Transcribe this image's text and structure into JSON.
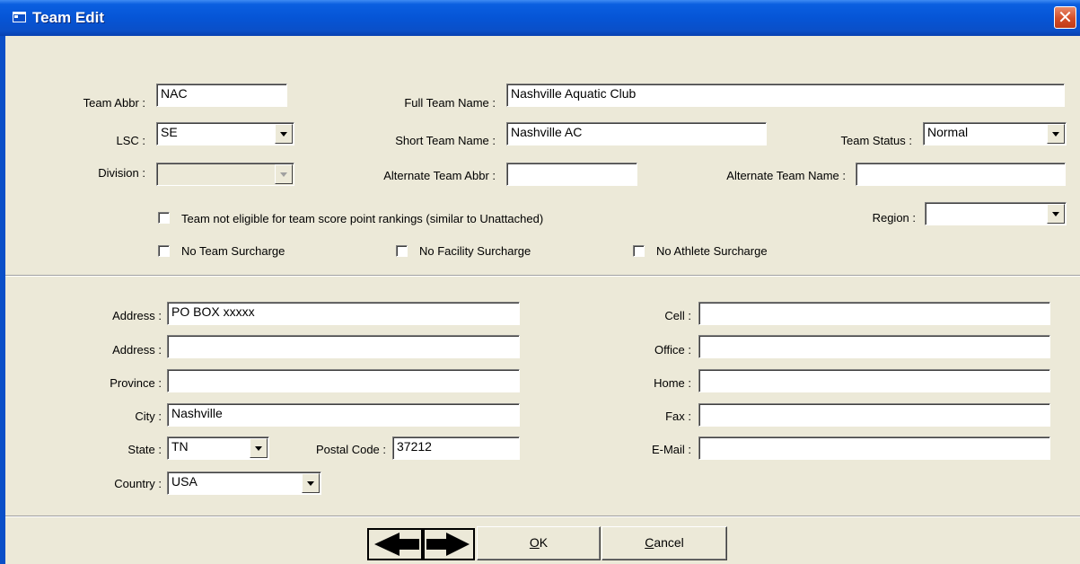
{
  "window": {
    "title": "Team Edit"
  },
  "team": {
    "abbr_label": "Team Abbr :",
    "abbr_value": "NAC",
    "full_name_label": "Full Team Name :",
    "full_name_value": "Nashville Aquatic Club",
    "lsc_label": "LSC :",
    "lsc_value": "SE",
    "short_name_label": "Short Team Name :",
    "short_name_value": "Nashville AC",
    "status_label": "Team Status :",
    "status_value": "Normal",
    "division_label": "Division :",
    "division_value": "",
    "alt_abbr_label": "Alternate Team Abbr :",
    "alt_abbr_value": "",
    "alt_name_label": "Alternate Team Name :",
    "alt_name_value": "",
    "region_label": "Region :",
    "region_value": ""
  },
  "options": {
    "not_eligible": {
      "label": "Team not eligible for team score point rankings (similar to Unattached)",
      "checked": false
    },
    "no_team_surcharge": {
      "label": "No Team Surcharge",
      "checked": false
    },
    "no_facility_surcharge": {
      "label": "No Facility Surcharge",
      "checked": false
    },
    "no_athlete_surcharge": {
      "label": "No Athlete Surcharge",
      "checked": false
    }
  },
  "contact": {
    "address1_label": "Address :",
    "address1_value": "PO BOX xxxxx",
    "address2_label": "Address :",
    "address2_value": "",
    "province_label": "Province :",
    "province_value": "",
    "city_label": "City :",
    "city_value": "Nashville",
    "state_label": "State :",
    "state_value": "TN",
    "postal_label": "Postal Code :",
    "postal_value": "37212",
    "country_label": "Country :",
    "country_value": "USA",
    "cell_label": "Cell :",
    "cell_value": "",
    "office_label": "Office :",
    "office_value": "",
    "home_label": "Home :",
    "home_value": "",
    "fax_label": "Fax :",
    "fax_value": "",
    "email_label": "E-Mail :",
    "email_value": ""
  },
  "buttons": {
    "prev_icon": "arrow-left-icon",
    "next_icon": "arrow-right-icon",
    "ok_accel": "O",
    "ok_rest": "K",
    "cancel_accel": "C",
    "cancel_rest": "ancel"
  }
}
